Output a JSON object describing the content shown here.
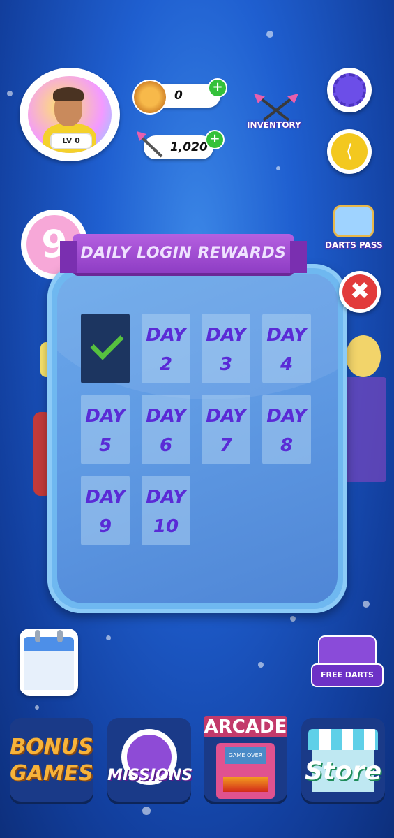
{
  "hud": {
    "level_label": "LV 0",
    "coins_value": "0",
    "darts_value": "1,020",
    "plus_label": "+",
    "inventory_label": "INVENTORY",
    "darts_pass_label": "DARTS PASS",
    "level_badge_number": "9"
  },
  "modal": {
    "title": "DAILY LOGIN REWARDS",
    "close_symbol": "✖",
    "days": [
      {
        "word": "DAY",
        "num": "2"
      },
      {
        "word": "DAY",
        "num": "3"
      },
      {
        "word": "DAY",
        "num": "4"
      },
      {
        "word": "DAY",
        "num": "5"
      },
      {
        "word": "DAY",
        "num": "6"
      },
      {
        "word": "DAY",
        "num": "7"
      },
      {
        "word": "DAY",
        "num": "8"
      },
      {
        "word": "DAY",
        "num": "9"
      },
      {
        "word": "DAY",
        "num": "10"
      }
    ]
  },
  "bottom": {
    "bonus_games_line1": "BONUS",
    "bonus_games_line2": "GAMES",
    "missions_label": "MISSIONS",
    "arcade_label": "ARCADE",
    "arcade_screen": "GAME OVER",
    "store_label": "Store",
    "free_darts_label": "FREE DARTS"
  },
  "colors": {
    "background": "#1f5fd0",
    "modal": "#6fb8f0",
    "ribbon": "#9a45cc",
    "day_text": "#5a2bd6",
    "checked_tile": "#1c3560",
    "check": "#56c13f"
  }
}
